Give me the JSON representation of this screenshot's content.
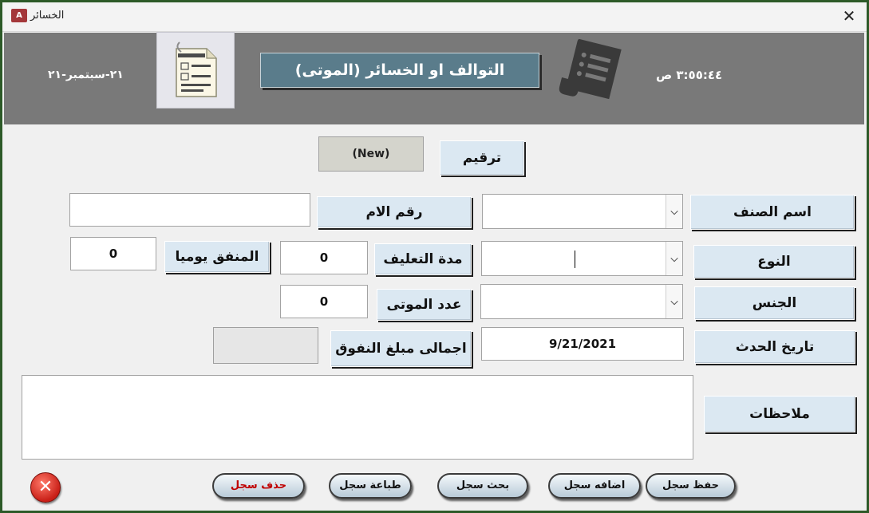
{
  "window": {
    "title": "الخسائر",
    "app_icon": "access-icon",
    "close_label": "✕"
  },
  "header": {
    "date": "٢١-سبتمبر-٢١",
    "title": "التوالف او الخسائر (الموتى)",
    "time": "٣:٥٥:٤٤ ص",
    "doc_icon": "document-icon",
    "receipt_icon": "receipt-icon",
    "band_color": "#797979",
    "title_color": "#5a7c8b"
  },
  "form": {
    "number": {
      "label": "ترقيم",
      "value": "(New)"
    },
    "category_name": {
      "label": "اسم الصنف",
      "value": ""
    },
    "mother_number": {
      "label": "رقم الام",
      "value": ""
    },
    "type": {
      "label": "النوع",
      "value": ""
    },
    "feeding_period": {
      "label": "مدة التعليف",
      "value": "0"
    },
    "daily_spent": {
      "label": "المنفق يوميا",
      "value": "0"
    },
    "gender": {
      "label": "الجنس",
      "value": ""
    },
    "deaths_count": {
      "label": "عدد الموتى",
      "value": "0"
    },
    "event_date": {
      "label": "تاريخ الحدث",
      "value": "9/21/2021"
    },
    "total_spend": {
      "label": "اجمالى مبلغ النفوق",
      "value": ""
    },
    "notes": {
      "label": "ملاحظات",
      "value": ""
    }
  },
  "buttons": {
    "save": "حفظ سجل",
    "add": "اضافه سجل",
    "search": "بحث سجل",
    "print": "طباعة سجل",
    "delete": "حذف سجل",
    "delete_color": "#c00000",
    "exit_icon": "exit-icon"
  }
}
